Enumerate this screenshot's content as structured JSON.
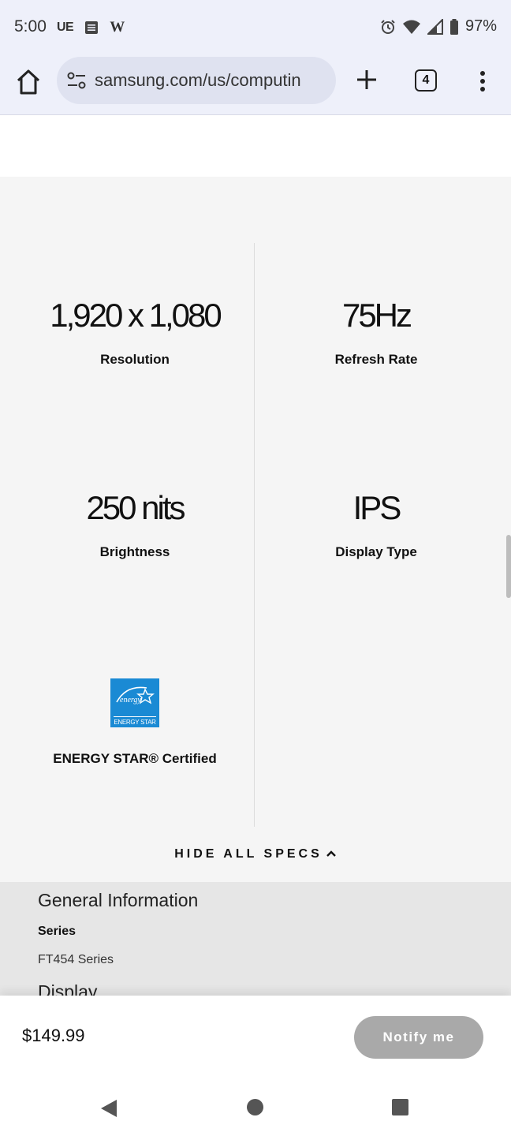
{
  "status_bar": {
    "time": "5:00",
    "left_icons": [
      "UE",
      "news-icon",
      "W"
    ],
    "battery": "97%"
  },
  "browser": {
    "url": "samsung.com/us/computin",
    "tab_count": "4"
  },
  "specs": [
    {
      "value": "1,920 x 1,080",
      "label": "Resolution"
    },
    {
      "value": "75Hz",
      "label": "Refresh Rate"
    },
    {
      "value": "250 nits",
      "label": "Brightness"
    },
    {
      "value": "IPS",
      "label": "Display Type"
    },
    {
      "logo": "energy-star-logo",
      "logo_text": "ENERGY STAR",
      "label": "ENERGY STAR® Certified"
    }
  ],
  "hide_specs_label": "HIDE ALL SPECS",
  "general_info": {
    "title": "General Information",
    "series_label": "Series",
    "series_value": "FT454 Series",
    "next_section": "Display"
  },
  "purchase": {
    "price": "$149.99",
    "button": "Notify me"
  },
  "colors": {
    "chrome_bg": "#eef0fa",
    "url_pill": "#dfe2f0",
    "specs_bg": "#f5f5f5",
    "energy_blue": "#1a8ad4",
    "button_disabled": "#a9a9a9"
  }
}
